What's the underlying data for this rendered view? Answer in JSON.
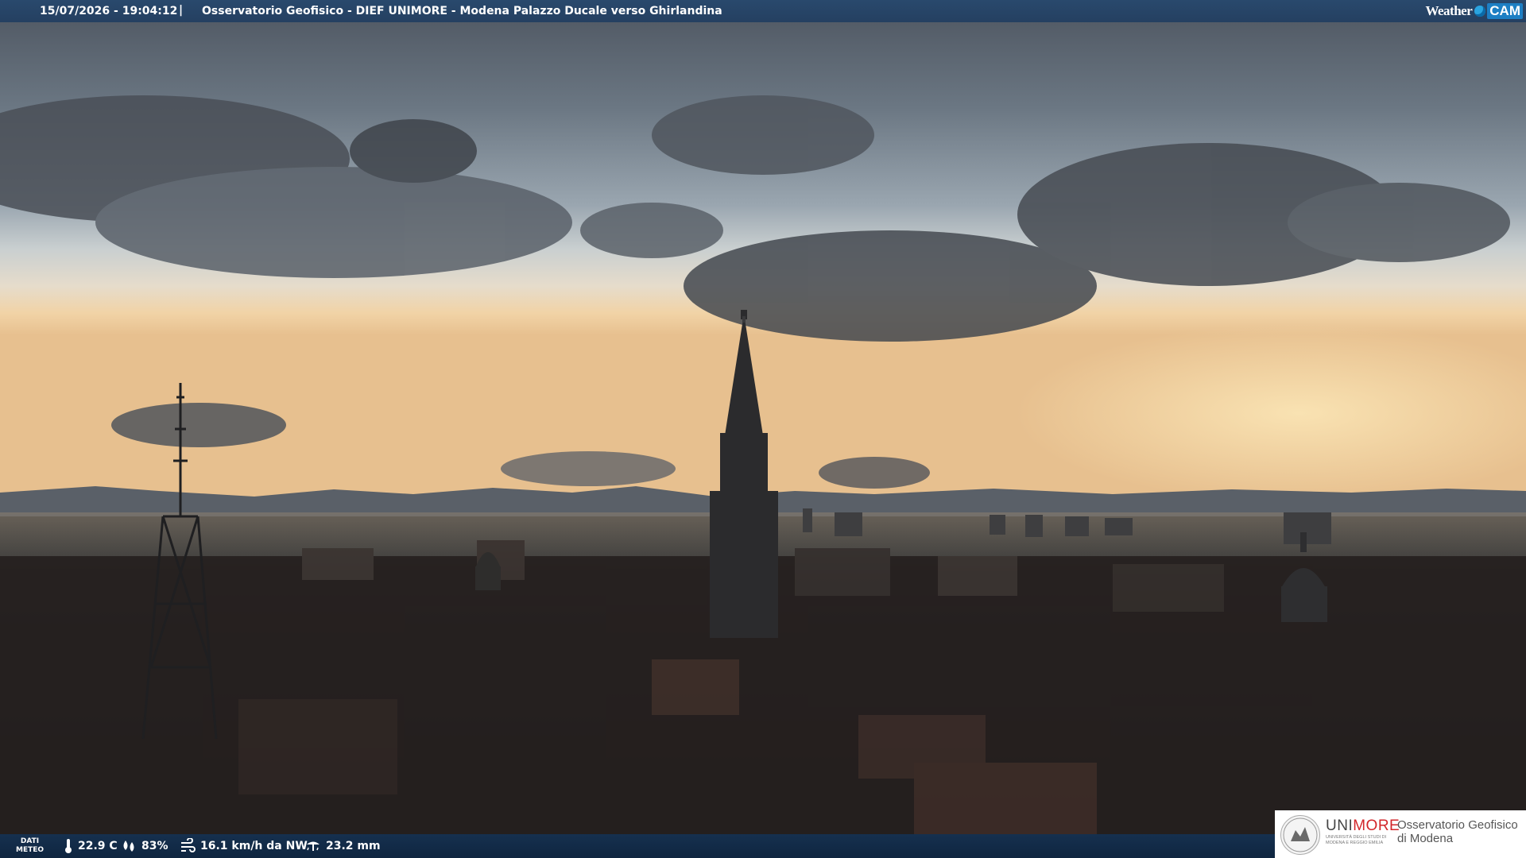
{
  "header": {
    "timestamp": "15/07/2026 - 19:04:12",
    "separator": "|",
    "title": "Osservatorio Geofisico - DIEF UNIMORE - Modena Palazzo Ducale verso Ghirlandina",
    "brand_weather": "Weather",
    "brand_cam": "CAM"
  },
  "footer": {
    "dati_label_1": "DATI",
    "dati_label_2": "METEO",
    "temperature": "22.9 C",
    "humidity": "83%",
    "wind": "16.1 km/h da NW",
    "rain": "23.2 mm",
    "icons": [
      "thermometer-icon",
      "humidity-drop-icon",
      "wind-icon",
      "rain-gauge-icon"
    ]
  },
  "logo": {
    "uni_prefix": "UNI",
    "uni_suffix": "MORE",
    "uni_sub": "UNIVERSITÀ DEGLI STUDI DI MODENA E REGGIO EMILIA",
    "observatory": "Osservatorio Geofisico di Modena"
  },
  "colors": {
    "bar": "#1e3c60",
    "brand_red": "#d2262a",
    "brand_blue": "#1d7fc4"
  }
}
